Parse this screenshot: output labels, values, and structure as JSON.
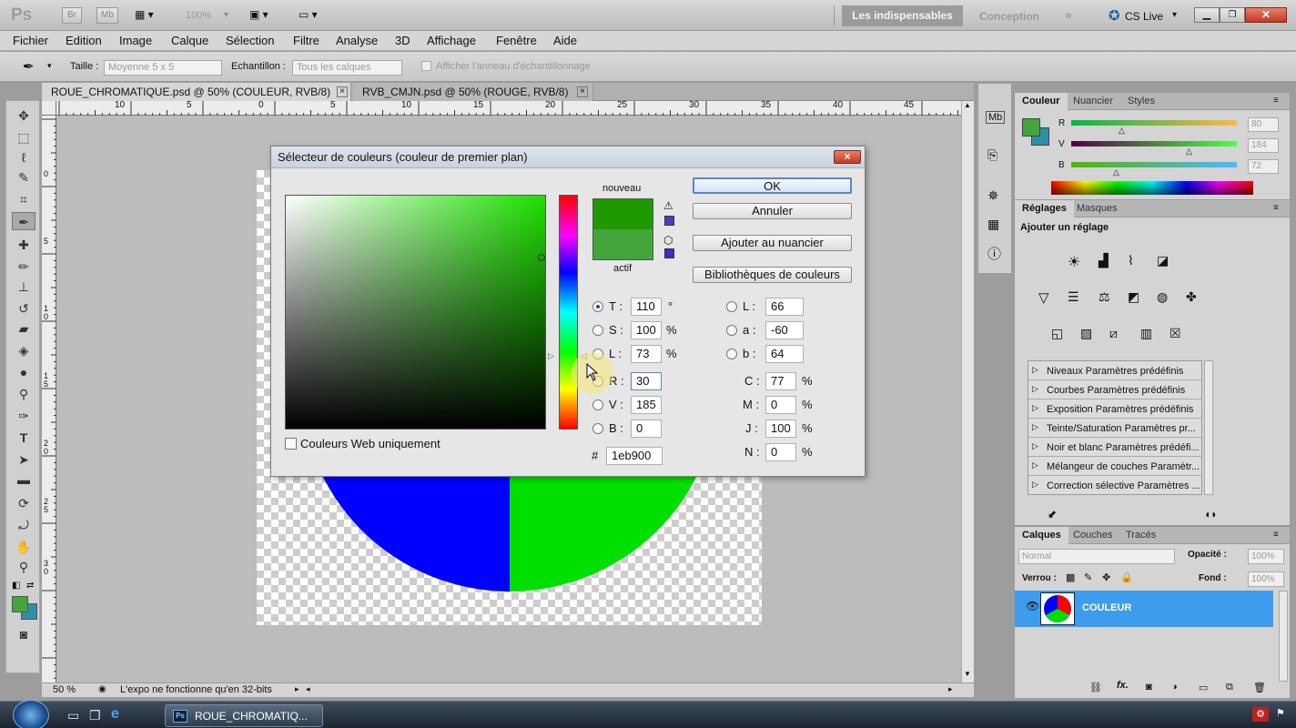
{
  "titlebar": {
    "app_logo": "Ps",
    "br": "Br",
    "mb": "Mb",
    "zoom": "100%",
    "workspace_active": "Les indispensables",
    "workspace_other": "Conception",
    "cs_live": "CS Live"
  },
  "menu": [
    "Fichier",
    "Edition",
    "Image",
    "Calque",
    "Sélection",
    "Filtre",
    "Analyse",
    "3D",
    "Affichage",
    "Fenêtre",
    "Aide"
  ],
  "options": {
    "size_label": "Taille :",
    "size_value": "Moyenne 5 x 5",
    "sample_label": "Echantillon :",
    "sample_value": "Tous les calques",
    "ring_label": "Afficher l'anneau d'échantillonnage"
  },
  "doc_tabs": [
    {
      "title": "ROUE_CHROMATIQUE.psd @ 50% (COULEUR, RVB/8)",
      "close": "×"
    },
    {
      "title": "RVB_CMJN.psd @ 50% (ROUGE, RVB/8)",
      "close": "×"
    }
  ],
  "ruler_h": [
    "10",
    "5",
    "0",
    "5",
    "10",
    "15",
    "20",
    "25",
    "30",
    "35",
    "40",
    "45"
  ],
  "ruler_v": [
    "0",
    "5",
    "1\n0",
    "1\n5",
    "2\n0",
    "2\n5",
    "3\n0"
  ],
  "status": {
    "zoom": "50 %",
    "message": "L'expo ne fonctionne qu'en 32-bits"
  },
  "dialog": {
    "title": "Sélecteur de couleurs (couleur de premier plan)",
    "close": "×",
    "new_label": "nouveau",
    "current_label": "actif",
    "new_color": "#1e9900",
    "current_color": "#42a63c",
    "ok": "OK",
    "cancel": "Annuler",
    "add_swatch": "Ajouter au nuancier",
    "libraries": "Bibliothèques de couleurs",
    "web_only": "Couleurs Web uniquement",
    "fields": {
      "H": {
        "label": "T :",
        "value": "110",
        "unit": "°"
      },
      "S": {
        "label": "S :",
        "value": "100",
        "unit": "%"
      },
      "Lum": {
        "label": "L :",
        "value": "73",
        "unit": "%"
      },
      "R": {
        "label": "R :",
        "value": "30"
      },
      "G": {
        "label": "V :",
        "value": "185"
      },
      "B": {
        "label": "B :",
        "value": "0"
      },
      "L": {
        "label": "L :",
        "value": "66"
      },
      "a": {
        "label": "a :",
        "value": "-60"
      },
      "b": {
        "label": "b :",
        "value": "64"
      },
      "C": {
        "label": "C :",
        "value": "77",
        "unit": "%"
      },
      "M": {
        "label": "M :",
        "value": "0",
        "unit": "%"
      },
      "J": {
        "label": "J :",
        "value": "100",
        "unit": "%"
      },
      "N": {
        "label": "N :",
        "value": "0",
        "unit": "%"
      },
      "hex_label": "#",
      "hex": "1eb900"
    }
  },
  "color_panel": {
    "tabs": [
      "Couleur",
      "Nuancier",
      "Styles"
    ],
    "channels": [
      {
        "label": "R",
        "value": "80"
      },
      {
        "label": "V",
        "value": "184"
      },
      {
        "label": "B",
        "value": "72"
      }
    ],
    "fg": "#42a63c",
    "bg": "#2f8fa8"
  },
  "adjust_panel": {
    "tabs": [
      "Réglages",
      "Masques"
    ],
    "heading": "Ajouter un réglage",
    "presets": [
      "Niveaux Paramètres prédéfinis",
      "Courbes Paramètres prédéfinis",
      "Exposition Paramètres prédéfinis",
      "Teinte/Saturation Paramètres pr...",
      "Noir et blanc Paramètres prédéfi...",
      "Mélangeur de couches Paramètr...",
      "Correction sélective Paramètres ..."
    ]
  },
  "layers_panel": {
    "tabs": [
      "Calques",
      "Couches",
      "Tracés"
    ],
    "blend": "Normal",
    "opacity_label": "Opacité :",
    "opacity": "100%",
    "lock_label": "Verrou :",
    "fill_label": "Fond :",
    "fill": "100%",
    "layer_name": "COULEUR",
    "fx": "fx."
  },
  "taskbar": {
    "app": "Ps",
    "item": "ROUE_CHROMATIQ..."
  }
}
